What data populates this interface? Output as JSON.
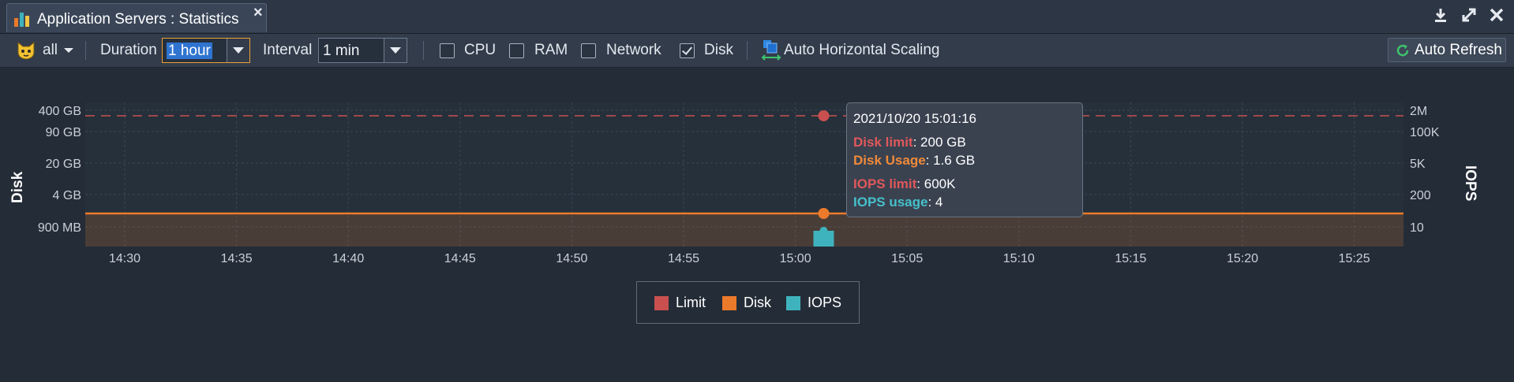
{
  "tab": {
    "title": "Application Servers : Statistics",
    "close": "×"
  },
  "toolbar": {
    "node_selector": "all",
    "duration_label": "Duration",
    "duration_value": "1 hour",
    "interval_label": "Interval",
    "interval_value": "1 min",
    "cpu_label": "CPU",
    "cpu_checked": false,
    "ram_label": "RAM",
    "ram_checked": false,
    "network_label": "Network",
    "network_checked": false,
    "disk_label": "Disk",
    "disk_checked": true,
    "scaling_label": "Auto Horizontal Scaling",
    "refresh_label": "Auto Refresh"
  },
  "colors": {
    "limit": "#c9504f",
    "disk": "#ec7a2b",
    "iops": "#3fb3bd",
    "background": "#242c37",
    "tooltip_date": "#ffffff"
  },
  "tooltip": {
    "date": "2021/10/20 15:01:16",
    "disk_limit_label": "Disk limit",
    "disk_limit_value": ": 200 GB",
    "disk_usage_label": "Disk Usage",
    "disk_usage_value": ": 1.6 GB",
    "iops_limit_label": "IOPS limit",
    "iops_limit_value": ": 600K",
    "iops_usage_label": "IOPS usage",
    "iops_usage_value": ": 4"
  },
  "chart_data": {
    "type": "line",
    "xlabel": "",
    "ylabel_left": "Disk",
    "ylabel_right": "IOPS",
    "x_ticks": [
      "14:30",
      "14:35",
      "14:40",
      "14:45",
      "14:50",
      "14:55",
      "15:00",
      "15:05",
      "15:10",
      "15:15",
      "15:20",
      "15:25"
    ],
    "y_left_ticks": [
      "400 GB",
      "90 GB",
      "20 GB",
      "4 GB",
      "900 MB"
    ],
    "y_right_ticks": [
      "2M",
      "100K",
      "5K",
      "200",
      "10"
    ],
    "log_scale": true,
    "grid": true,
    "legend_position": "bottom-center",
    "series": [
      {
        "name": "Limit",
        "style": "dashed",
        "value": "200 GB"
      },
      {
        "name": "Disk",
        "style": "area",
        "value": "1.6 GB"
      },
      {
        "name": "IOPS",
        "style": "bar",
        "x": "15:01",
        "value": 4
      }
    ],
    "highlight_x": "15:01:16"
  }
}
